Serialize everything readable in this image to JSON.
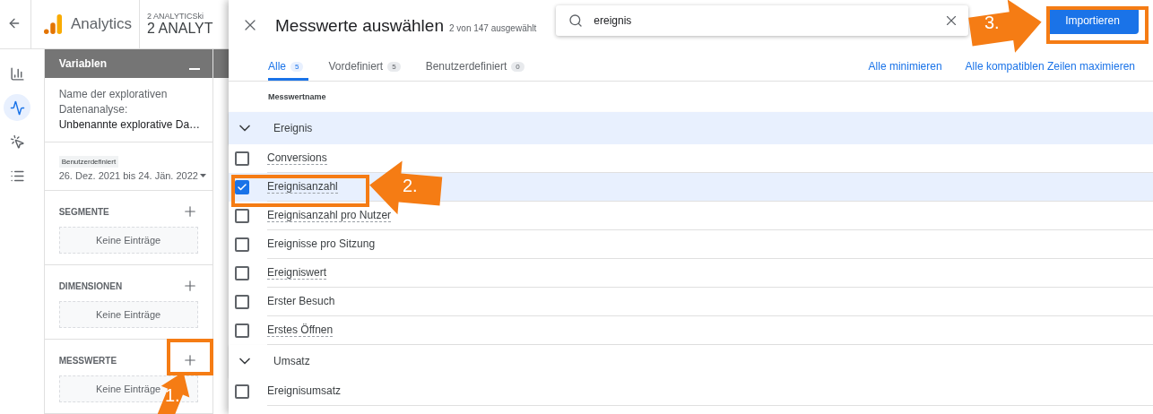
{
  "app_header": {
    "product": "Analytics",
    "account_line": "2 ANALYTICSki",
    "property": "2 ANALYT"
  },
  "rail": {
    "items": [
      {
        "selected": false
      },
      {
        "selected": true
      },
      {
        "selected": false
      },
      {
        "selected": false
      }
    ]
  },
  "variables_panel": {
    "title": "Variablen",
    "name_label": "Name der explorativen Datenanalyse:",
    "name_value": "Unbenannte explorative Da…",
    "date_chip": "Benutzerdefiniert",
    "date_range": "26. Dez. 2021 bis 24. Jän. 2022",
    "sections": [
      {
        "title": "SEGMENTE",
        "empty": "Keine Einträge"
      },
      {
        "title": "DIMENSIONEN",
        "empty": "Keine Einträge"
      },
      {
        "title": "MESSWERTE",
        "empty": "Keine Einträge"
      }
    ]
  },
  "dialog": {
    "title": "Messwerte auswählen",
    "subtitle": "2 von 147 ausgewählt",
    "search": {
      "value": "ereignis"
    },
    "import_button": "Importieren",
    "tabs": [
      {
        "label": "Alle",
        "count": "5",
        "selected": true
      },
      {
        "label": "Vordefiniert",
        "count": "5",
        "selected": false
      },
      {
        "label": "Benutzerdefiniert",
        "count": "0",
        "selected": false
      }
    ],
    "links": [
      "Alle minimieren",
      "Alle kompatiblen Zeilen maximieren"
    ],
    "column": "Messwertname",
    "items": [
      {
        "kind": "group",
        "label": "Ereignis",
        "expanded": true,
        "highlighted": true
      },
      {
        "kind": "metric",
        "label": "Conversions",
        "checked": false,
        "has_tooltip": true
      },
      {
        "kind": "metric",
        "label": "Ereignisanzahl",
        "checked": true,
        "has_tooltip": true
      },
      {
        "kind": "metric",
        "label": "Ereignisanzahl pro Nutzer",
        "checked": false,
        "has_tooltip": true
      },
      {
        "kind": "metric",
        "label": "Ereignisse pro Sitzung",
        "checked": false,
        "has_tooltip": false
      },
      {
        "kind": "metric",
        "label": "Ereigniswert",
        "checked": false,
        "has_tooltip": true
      },
      {
        "kind": "metric",
        "label": "Erster Besuch",
        "checked": false,
        "has_tooltip": false
      },
      {
        "kind": "metric",
        "label": "Erstes Öffnen",
        "checked": false,
        "has_tooltip": true
      },
      {
        "kind": "group",
        "label": "Umsatz",
        "expanded": true,
        "highlighted": false
      },
      {
        "kind": "metric",
        "label": "Ereignisumsatz",
        "checked": false,
        "has_tooltip": false
      }
    ]
  },
  "annotations": [
    {
      "label": "1."
    },
    {
      "label": "2."
    },
    {
      "label": "3."
    }
  ]
}
